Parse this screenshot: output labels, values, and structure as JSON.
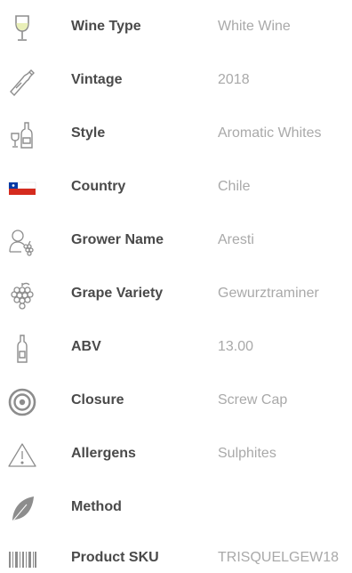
{
  "specs": [
    {
      "icon": "wine-glass-icon",
      "label": "Wine Type",
      "value": "White Wine"
    },
    {
      "icon": "bottle-icon",
      "label": "Vintage",
      "value": "2018"
    },
    {
      "icon": "bottle-and-glass-icon",
      "label": "Style",
      "value": "Aromatic Whites"
    },
    {
      "icon": "chile-flag-icon",
      "label": "Country",
      "value": "Chile"
    },
    {
      "icon": "grower-icon",
      "label": "Grower Name",
      "value": "Aresti"
    },
    {
      "icon": "grapes-icon",
      "label": "Grape Variety",
      "value": "Gewurztraminer"
    },
    {
      "icon": "abv-bottle-icon",
      "label": "ABV",
      "value": "13.00"
    },
    {
      "icon": "closure-target-icon",
      "label": "Closure",
      "value": "Screw Cap"
    },
    {
      "icon": "warning-triangle-icon",
      "label": "Allergens",
      "value": "Sulphites"
    },
    {
      "icon": "leaf-icon",
      "label": "Method",
      "value": ""
    },
    {
      "icon": "barcode-icon",
      "label": "Product SKU",
      "value": "TRISQUELGEW18"
    }
  ],
  "colors": {
    "label": "#4a4a4a",
    "value": "#a9a9a9",
    "icon": "#8d8d8d",
    "flag_red": "#d52b1e",
    "flag_blue": "#0039a6"
  }
}
